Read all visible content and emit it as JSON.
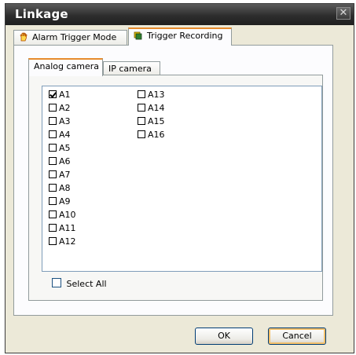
{
  "window": {
    "title": "Linkage",
    "close_glyph": "✕"
  },
  "outer_tabs": [
    {
      "label": "Alarm Trigger Mode",
      "icon": "hand-icon",
      "active": false
    },
    {
      "label": "Trigger Recording",
      "icon": "recording-icon",
      "active": true
    }
  ],
  "inner_tabs": [
    {
      "label": "Analog camera",
      "active": true
    },
    {
      "label": "IP camera",
      "active": false
    }
  ],
  "cameras": [
    {
      "label": "A1",
      "checked": true
    },
    {
      "label": "A2",
      "checked": false
    },
    {
      "label": "A3",
      "checked": false
    },
    {
      "label": "A4",
      "checked": false
    },
    {
      "label": "A5",
      "checked": false
    },
    {
      "label": "A6",
      "checked": false
    },
    {
      "label": "A7",
      "checked": false
    },
    {
      "label": "A8",
      "checked": false
    },
    {
      "label": "A9",
      "checked": false
    },
    {
      "label": "A10",
      "checked": false
    },
    {
      "label": "A11",
      "checked": false
    },
    {
      "label": "A12",
      "checked": false
    },
    {
      "label": "A13",
      "checked": false
    },
    {
      "label": "A14",
      "checked": false
    },
    {
      "label": "A15",
      "checked": false
    },
    {
      "label": "A16",
      "checked": false
    }
  ],
  "select_all": {
    "label": "Select All",
    "checked": false
  },
  "buttons": {
    "ok": "OK",
    "cancel": "Cancel"
  },
  "colors": {
    "title_bar": "#2e2e2e",
    "active_tab_accent": "#e68b2c",
    "list_border": "#7f9db9"
  }
}
